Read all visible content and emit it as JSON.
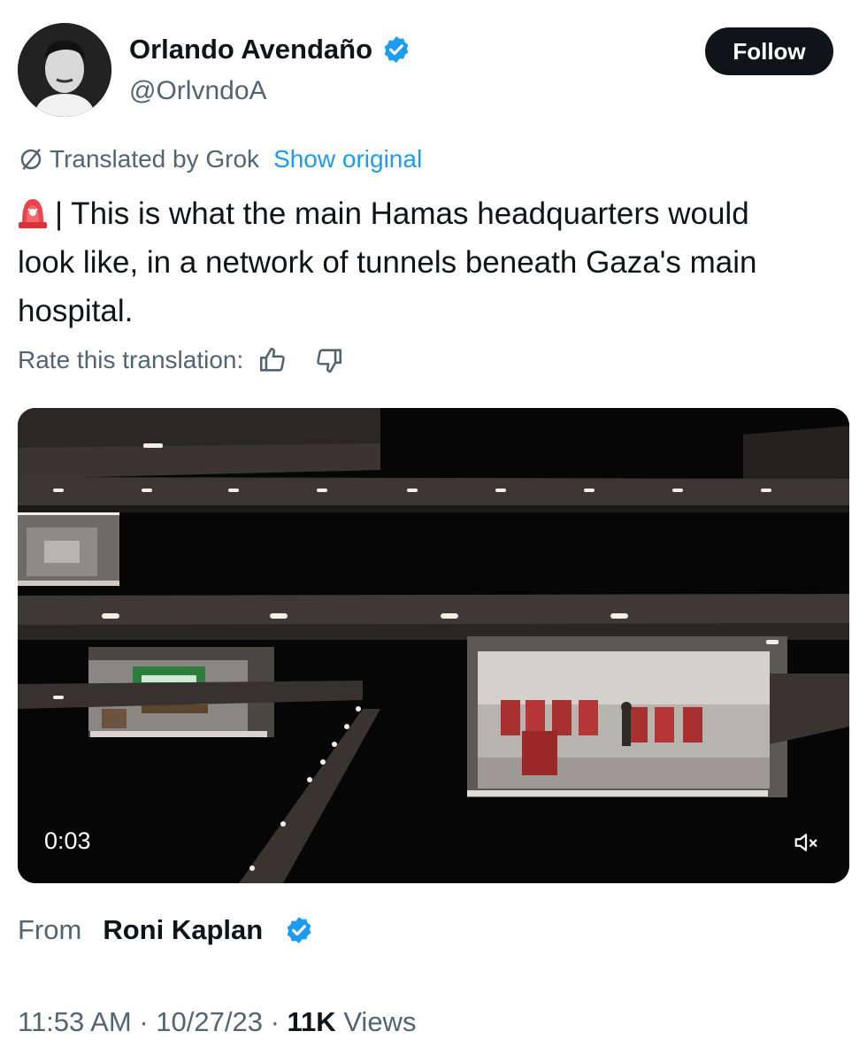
{
  "author": {
    "name": "Orlando Avendaño",
    "handle": "@OrlvndoA",
    "verified": true
  },
  "follow_label": "Follow",
  "translation": {
    "label": "Translated by Grok",
    "show_original": "Show original",
    "rate_label": "Rate this translation:"
  },
  "post": {
    "emoji": "siren-icon",
    "text": "| This is what the main Hamas headquarters would look like, in a network of tunnels beneath Gaza's main hospital."
  },
  "video": {
    "timestamp": "0:03",
    "muted": true
  },
  "source": {
    "from_label": "From",
    "name": "Roni Kaplan",
    "verified": true
  },
  "meta": {
    "time": "11:53 AM",
    "date": "10/27/23",
    "separator": "·",
    "views_count": "11K",
    "views_label": "Views"
  },
  "colors": {
    "accent": "#1d9bf0",
    "text": "#0f1419",
    "muted": "#536471"
  }
}
